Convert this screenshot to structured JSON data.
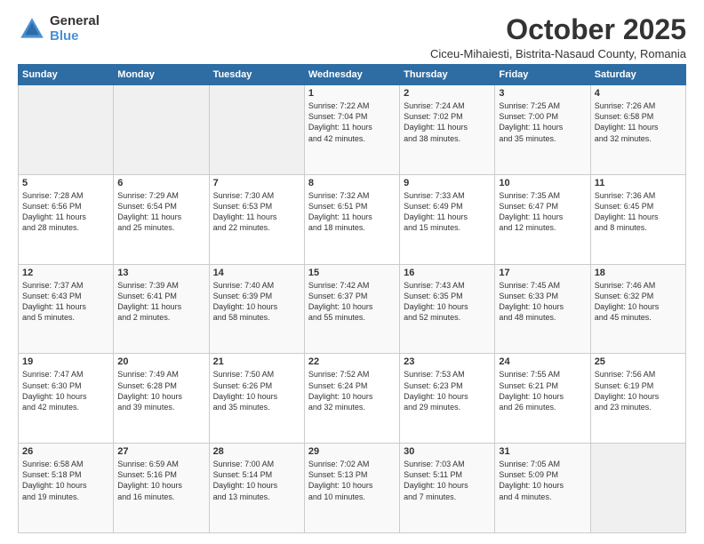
{
  "header": {
    "logo_general": "General",
    "logo_blue": "Blue",
    "title": "October 2025",
    "subtitle": "Ciceu-Mihaiesti, Bistrita-Nasaud County, Romania"
  },
  "days_of_week": [
    "Sunday",
    "Monday",
    "Tuesday",
    "Wednesday",
    "Thursday",
    "Friday",
    "Saturday"
  ],
  "weeks": [
    [
      {
        "day": "",
        "info": ""
      },
      {
        "day": "",
        "info": ""
      },
      {
        "day": "",
        "info": ""
      },
      {
        "day": "1",
        "info": "Sunrise: 7:22 AM\nSunset: 7:04 PM\nDaylight: 11 hours\nand 42 minutes."
      },
      {
        "day": "2",
        "info": "Sunrise: 7:24 AM\nSunset: 7:02 PM\nDaylight: 11 hours\nand 38 minutes."
      },
      {
        "day": "3",
        "info": "Sunrise: 7:25 AM\nSunset: 7:00 PM\nDaylight: 11 hours\nand 35 minutes."
      },
      {
        "day": "4",
        "info": "Sunrise: 7:26 AM\nSunset: 6:58 PM\nDaylight: 11 hours\nand 32 minutes."
      }
    ],
    [
      {
        "day": "5",
        "info": "Sunrise: 7:28 AM\nSunset: 6:56 PM\nDaylight: 11 hours\nand 28 minutes."
      },
      {
        "day": "6",
        "info": "Sunrise: 7:29 AM\nSunset: 6:54 PM\nDaylight: 11 hours\nand 25 minutes."
      },
      {
        "day": "7",
        "info": "Sunrise: 7:30 AM\nSunset: 6:53 PM\nDaylight: 11 hours\nand 22 minutes."
      },
      {
        "day": "8",
        "info": "Sunrise: 7:32 AM\nSunset: 6:51 PM\nDaylight: 11 hours\nand 18 minutes."
      },
      {
        "day": "9",
        "info": "Sunrise: 7:33 AM\nSunset: 6:49 PM\nDaylight: 11 hours\nand 15 minutes."
      },
      {
        "day": "10",
        "info": "Sunrise: 7:35 AM\nSunset: 6:47 PM\nDaylight: 11 hours\nand 12 minutes."
      },
      {
        "day": "11",
        "info": "Sunrise: 7:36 AM\nSunset: 6:45 PM\nDaylight: 11 hours\nand 8 minutes."
      }
    ],
    [
      {
        "day": "12",
        "info": "Sunrise: 7:37 AM\nSunset: 6:43 PM\nDaylight: 11 hours\nand 5 minutes."
      },
      {
        "day": "13",
        "info": "Sunrise: 7:39 AM\nSunset: 6:41 PM\nDaylight: 11 hours\nand 2 minutes."
      },
      {
        "day": "14",
        "info": "Sunrise: 7:40 AM\nSunset: 6:39 PM\nDaylight: 10 hours\nand 58 minutes."
      },
      {
        "day": "15",
        "info": "Sunrise: 7:42 AM\nSunset: 6:37 PM\nDaylight: 10 hours\nand 55 minutes."
      },
      {
        "day": "16",
        "info": "Sunrise: 7:43 AM\nSunset: 6:35 PM\nDaylight: 10 hours\nand 52 minutes."
      },
      {
        "day": "17",
        "info": "Sunrise: 7:45 AM\nSunset: 6:33 PM\nDaylight: 10 hours\nand 48 minutes."
      },
      {
        "day": "18",
        "info": "Sunrise: 7:46 AM\nSunset: 6:32 PM\nDaylight: 10 hours\nand 45 minutes."
      }
    ],
    [
      {
        "day": "19",
        "info": "Sunrise: 7:47 AM\nSunset: 6:30 PM\nDaylight: 10 hours\nand 42 minutes."
      },
      {
        "day": "20",
        "info": "Sunrise: 7:49 AM\nSunset: 6:28 PM\nDaylight: 10 hours\nand 39 minutes."
      },
      {
        "day": "21",
        "info": "Sunrise: 7:50 AM\nSunset: 6:26 PM\nDaylight: 10 hours\nand 35 minutes."
      },
      {
        "day": "22",
        "info": "Sunrise: 7:52 AM\nSunset: 6:24 PM\nDaylight: 10 hours\nand 32 minutes."
      },
      {
        "day": "23",
        "info": "Sunrise: 7:53 AM\nSunset: 6:23 PM\nDaylight: 10 hours\nand 29 minutes."
      },
      {
        "day": "24",
        "info": "Sunrise: 7:55 AM\nSunset: 6:21 PM\nDaylight: 10 hours\nand 26 minutes."
      },
      {
        "day": "25",
        "info": "Sunrise: 7:56 AM\nSunset: 6:19 PM\nDaylight: 10 hours\nand 23 minutes."
      }
    ],
    [
      {
        "day": "26",
        "info": "Sunrise: 6:58 AM\nSunset: 5:18 PM\nDaylight: 10 hours\nand 19 minutes."
      },
      {
        "day": "27",
        "info": "Sunrise: 6:59 AM\nSunset: 5:16 PM\nDaylight: 10 hours\nand 16 minutes."
      },
      {
        "day": "28",
        "info": "Sunrise: 7:00 AM\nSunset: 5:14 PM\nDaylight: 10 hours\nand 13 minutes."
      },
      {
        "day": "29",
        "info": "Sunrise: 7:02 AM\nSunset: 5:13 PM\nDaylight: 10 hours\nand 10 minutes."
      },
      {
        "day": "30",
        "info": "Sunrise: 7:03 AM\nSunset: 5:11 PM\nDaylight: 10 hours\nand 7 minutes."
      },
      {
        "day": "31",
        "info": "Sunrise: 7:05 AM\nSunset: 5:09 PM\nDaylight: 10 hours\nand 4 minutes."
      },
      {
        "day": "",
        "info": ""
      }
    ]
  ]
}
